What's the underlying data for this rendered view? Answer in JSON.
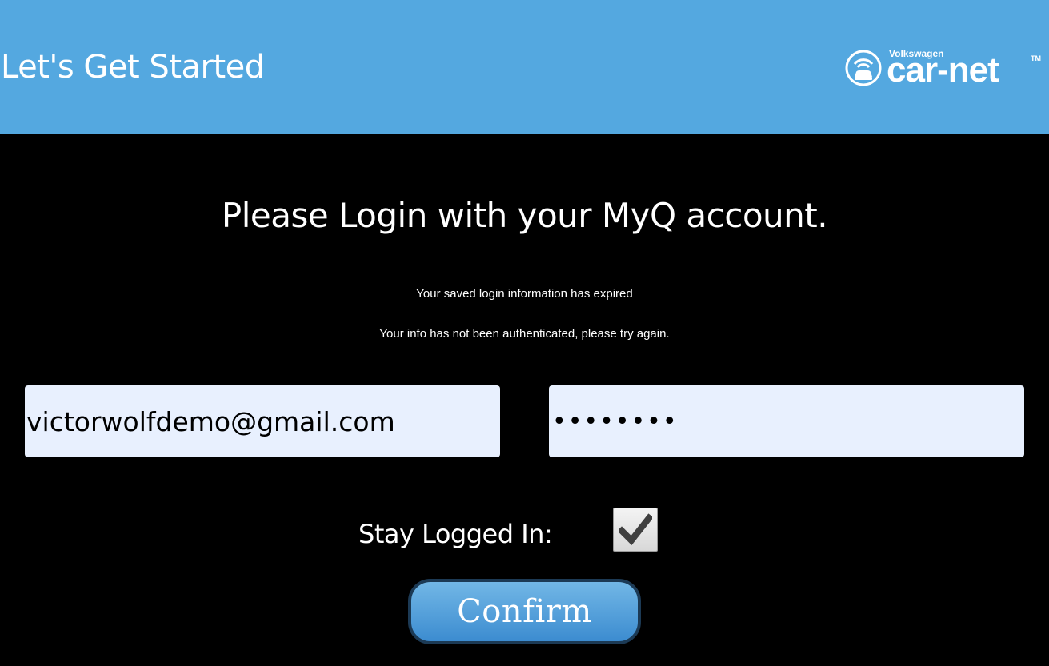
{
  "header": {
    "title": "Let's Get Started",
    "logo": {
      "brand": "Volkswagen",
      "name": "car-net",
      "trademark": "TM",
      "icon": "car-wifi-icon"
    },
    "background_color": "#54a8e0"
  },
  "main": {
    "heading": "Please Login with your MyQ account.",
    "messages": {
      "expired": "Your saved login information has expired",
      "auth_failed": "Your info has not been authenticated, please try again."
    }
  },
  "form": {
    "email": {
      "value": "victorwolfdemo@gmail.com"
    },
    "password": {
      "value": "••••••••"
    },
    "stay_logged_in": {
      "label": "Stay Logged In:",
      "checked": true,
      "icon": "checkmark-icon"
    },
    "confirm_label": "Confirm"
  }
}
